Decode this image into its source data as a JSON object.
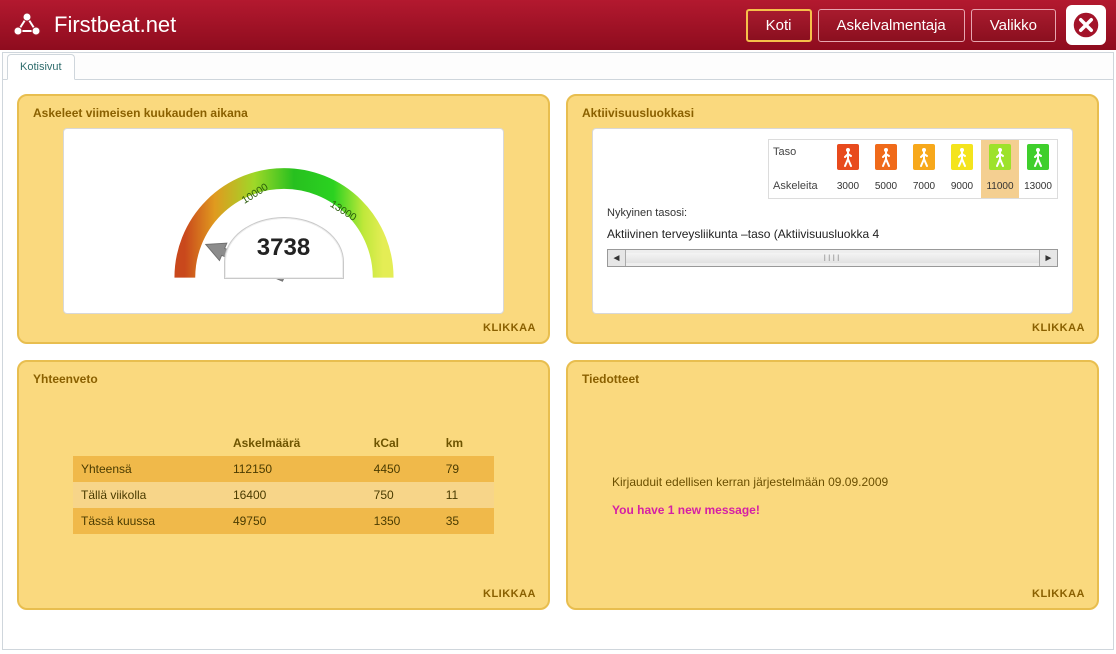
{
  "header": {
    "brand": "Firstbeat.net",
    "nav": [
      {
        "label": "Koti",
        "active": true
      },
      {
        "label": "Askelvalmentaja",
        "active": false
      },
      {
        "label": "Valikko",
        "active": false
      }
    ]
  },
  "tab": {
    "label": "Kotisivut"
  },
  "panels": {
    "steps": {
      "title": "Askeleet viimeisen kuukauden aikana",
      "value": "3738",
      "ticks": [
        "10000",
        "13000"
      ],
      "action": "KLIKKAA"
    },
    "activity": {
      "title": "Aktiivisuusluokkasi",
      "row_labels": {
        "level": "Taso",
        "steps": "Askeleita"
      },
      "levels": [
        {
          "steps": "3000",
          "color": "#e84a1d"
        },
        {
          "steps": "5000",
          "color": "#f06a1a"
        },
        {
          "steps": "7000",
          "color": "#f7a81b"
        },
        {
          "steps": "9000",
          "color": "#f4e41d"
        },
        {
          "steps": "11000",
          "color": "#9de22a"
        },
        {
          "steps": "13000",
          "color": "#3fcf2c"
        }
      ],
      "highlight_index": 4,
      "current_label": "Nykyinen tasosi:",
      "current_value": "Aktiivinen terveysliikunta –taso (Aktiivisuusluokka 4",
      "action": "KLIKKAA"
    },
    "summary": {
      "title": "Yhteenveto",
      "columns": [
        "",
        "Askelmäärä",
        "kCal",
        "km"
      ],
      "rows": [
        {
          "label": "Yhteensä",
          "steps": "112150",
          "kcal": "4450",
          "km": "79"
        },
        {
          "label": "Tällä viikolla",
          "steps": "16400",
          "kcal": "750",
          "km": "11"
        },
        {
          "label": "Tässä kuussa",
          "steps": "49750",
          "kcal": "1350",
          "km": "35"
        }
      ],
      "action": "KLIKKAA"
    },
    "announcements": {
      "title": "Tiedotteet",
      "login_text": "Kirjauduit edellisen kerran järjestelmään 09.09.2009",
      "message": "You have 1 new message!",
      "action": "KLIKKAA"
    }
  },
  "chart_data": {
    "type": "gauge",
    "title": "Askeleet viimeisen kuukauden aikana",
    "value": 3738,
    "min": 0,
    "max": 16000,
    "ticks": [
      10000,
      13000
    ]
  }
}
